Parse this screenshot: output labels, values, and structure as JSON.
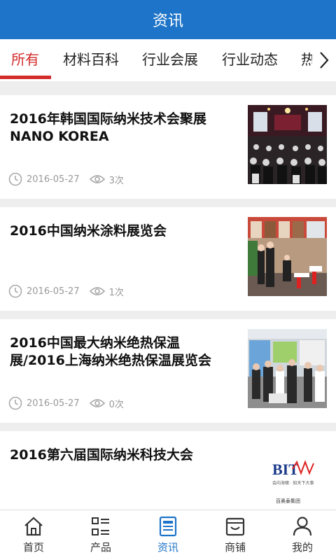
{
  "header": {
    "title": "资讯"
  },
  "tabs": [
    {
      "label": "所有"
    },
    {
      "label": "材料百科"
    },
    {
      "label": "行业会展"
    },
    {
      "label": "行业动态"
    },
    {
      "label": "热"
    }
  ],
  "articles": [
    {
      "title": "2016年韩国国际纳米技术会聚展NANO KOREA",
      "date": "2016-05-27",
      "views": "3次",
      "thumb_icon": "conference-hall-photo"
    },
    {
      "title": "2016中国纳米涂料展览会",
      "date": "2016-05-27",
      "views": "1次",
      "thumb_icon": "exhibition-booth-photo"
    },
    {
      "title": "2016中国最大纳米绝热保温展/2016上海纳米绝热保温展览会",
      "date": "2016-05-27",
      "views": "0次",
      "thumb_icon": "exhibition-visitors-photo"
    },
    {
      "title": "2016第六届国际纳米科技大会",
      "date": "",
      "views": "",
      "thumb_icon": "bit-logo"
    }
  ],
  "bit_logo": {
    "brand": "BIT",
    "tagline": "会向海啸 · 知天下大事",
    "name": "百奥泰集团"
  },
  "bottom_nav": [
    {
      "label": "首页",
      "icon": "home-icon"
    },
    {
      "label": "产品",
      "icon": "product-list-icon"
    },
    {
      "label": "资讯",
      "icon": "news-icon"
    },
    {
      "label": "商铺",
      "icon": "shop-icon"
    },
    {
      "label": "我的",
      "icon": "user-icon"
    }
  ],
  "colors": {
    "header_bg": "#1e74c8",
    "active_tab": "#d32a2a",
    "active_nav": "#1e74c8"
  }
}
